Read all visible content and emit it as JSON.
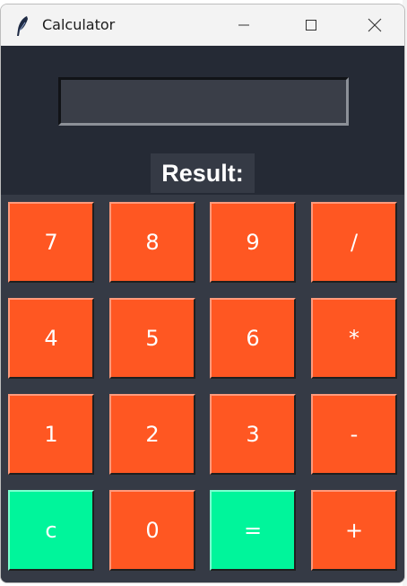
{
  "window": {
    "title": "Calculator"
  },
  "display": {
    "value": "",
    "result_label": "Result:"
  },
  "keys": [
    {
      "label": "7",
      "name": "key-7"
    },
    {
      "label": "8",
      "name": "key-8"
    },
    {
      "label": "9",
      "name": "key-9"
    },
    {
      "label": "/",
      "name": "key-divide"
    },
    {
      "label": "4",
      "name": "key-4"
    },
    {
      "label": "5",
      "name": "key-5"
    },
    {
      "label": "6",
      "name": "key-6"
    },
    {
      "label": "*",
      "name": "key-multiply"
    },
    {
      "label": "1",
      "name": "key-1"
    },
    {
      "label": "2",
      "name": "key-2"
    },
    {
      "label": "3",
      "name": "key-3"
    },
    {
      "label": "-",
      "name": "key-subtract"
    },
    {
      "label": "c",
      "name": "key-clear"
    },
    {
      "label": "0",
      "name": "key-0"
    },
    {
      "label": "=",
      "name": "key-equals"
    },
    {
      "label": "+",
      "name": "key-add"
    }
  ],
  "colors": {
    "background": "#252a35",
    "panel": "#353a45",
    "operator_key": "#ff5722",
    "accent_key": "#00f59b",
    "key_text": "#ffffff"
  }
}
